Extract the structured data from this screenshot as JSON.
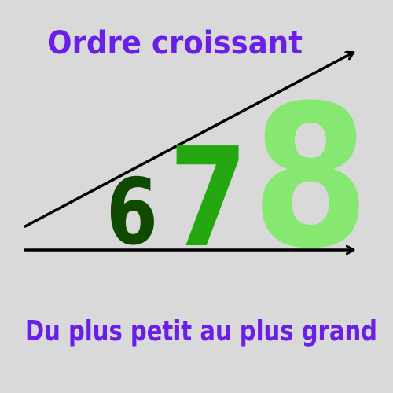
{
  "title": "Ordre croissant",
  "subtitle": "Du plus petit au plus grand",
  "numbers": [
    {
      "label": "6",
      "color": "#0f4a00"
    },
    {
      "label": "7",
      "color": "#25a80f"
    },
    {
      "label": "8",
      "color": "#86e871"
    }
  ],
  "colors": {
    "background": "#d9d9d9",
    "text": "#6a1fe8",
    "arrow": "#000000"
  }
}
